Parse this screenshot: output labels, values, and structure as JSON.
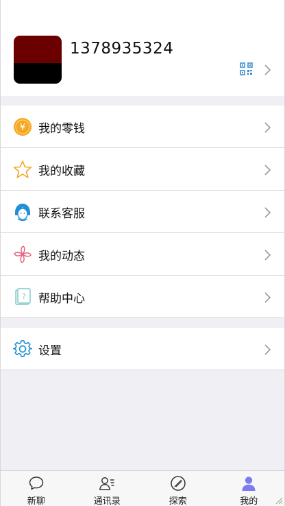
{
  "profile": {
    "username": "1378935324"
  },
  "menu_group_1": [
    {
      "label": "我的零钱",
      "icon": "coin-icon"
    },
    {
      "label": "我的收藏",
      "icon": "star-icon"
    },
    {
      "label": "联系客服",
      "icon": "customer-service-icon"
    },
    {
      "label": "我的动态",
      "icon": "pinwheel-icon"
    },
    {
      "label": "帮助中心",
      "icon": "help-book-icon"
    }
  ],
  "menu_group_2": [
    {
      "label": "设置",
      "icon": "settings-gear-icon"
    }
  ],
  "tabbar": {
    "items": [
      {
        "label": "新聊",
        "icon": "chat-bubble-icon"
      },
      {
        "label": "通讯录",
        "icon": "contacts-icon"
      },
      {
        "label": "探索",
        "icon": "compass-icon"
      },
      {
        "label": "我的",
        "icon": "user-profile-icon"
      }
    ],
    "active_index": 3,
    "active_color": "#7b7cf0"
  },
  "colors": {
    "accent_blue": "#1f8fd6",
    "coin": "#f5a623",
    "star": "#f5a623",
    "pinwheel": "#e8607e"
  }
}
